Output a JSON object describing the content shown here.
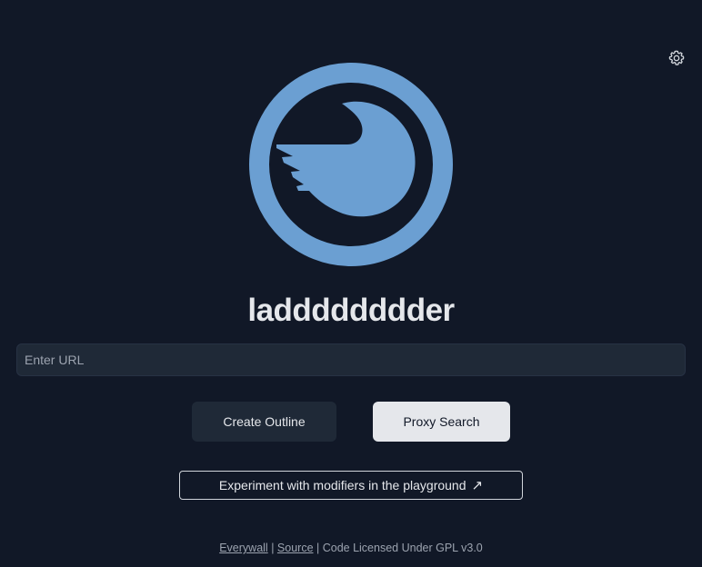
{
  "app": {
    "title": "ladddddddder",
    "logo_icon": "bird-circle-logo",
    "settings_icon": "gear-icon"
  },
  "search": {
    "placeholder": "Enter URL",
    "value": ""
  },
  "actions": {
    "outline_label": "Create Outline",
    "proxy_label": "Proxy Search",
    "playground_label": "Experiment with modifiers in the playground",
    "playground_arrow": "↗"
  },
  "footer": {
    "link1": "Everywall",
    "sep1": " | ",
    "link2": "Source",
    "license": " | Code Licensed Under GPL v3.0"
  },
  "colors": {
    "background": "#111827",
    "logo": "#6b9fd2",
    "surface": "#1f2937",
    "text": "#e5e7eb"
  }
}
